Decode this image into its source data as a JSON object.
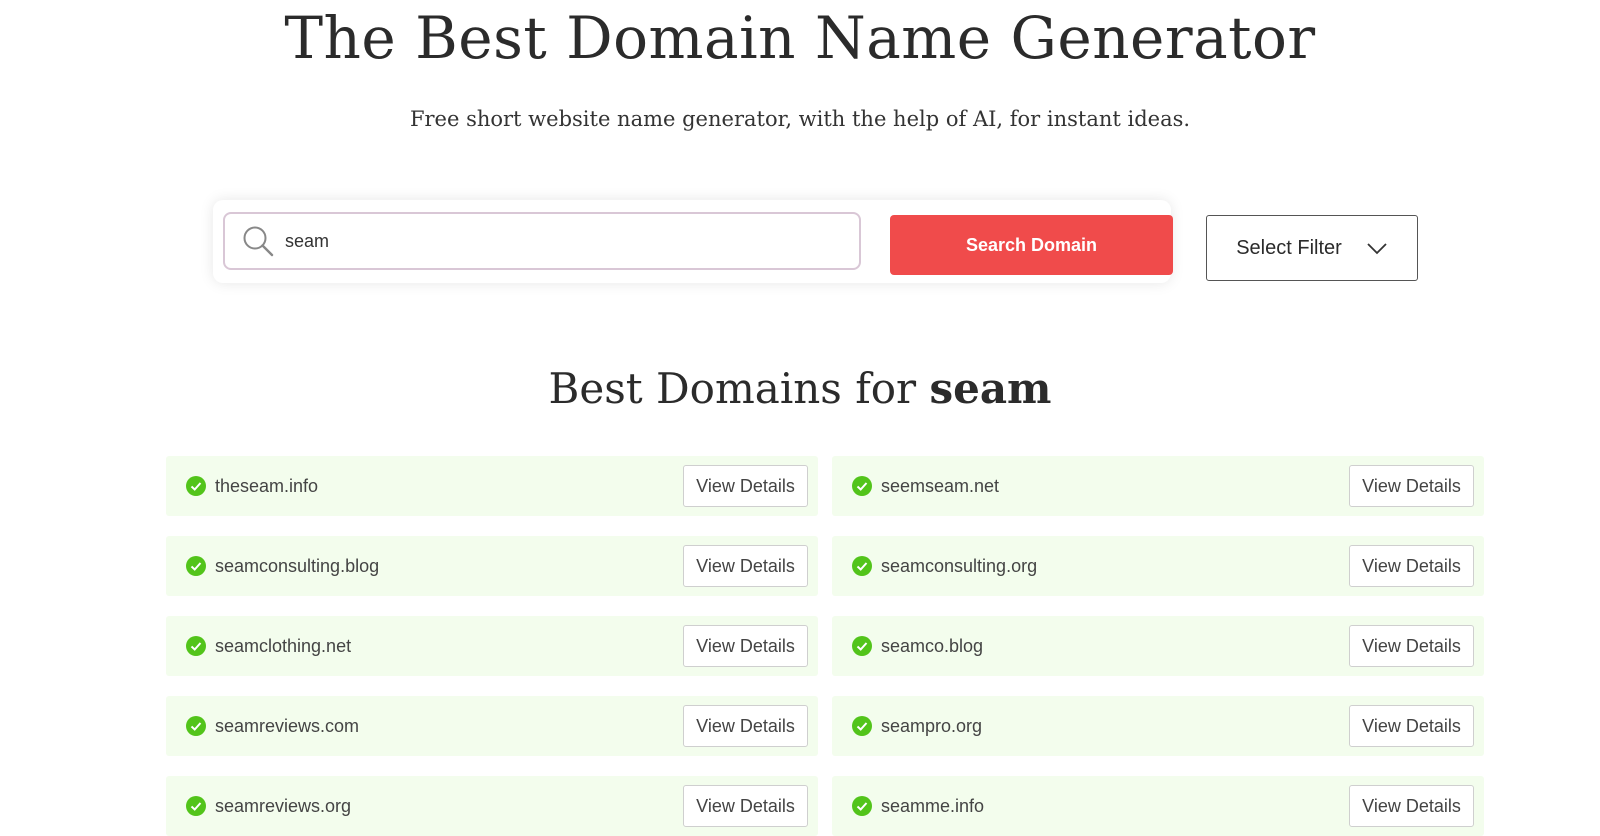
{
  "header": {
    "title": "The Best Domain Name Generator",
    "subtitle": "Free short website name generator, with the help of AI, for instant ideas."
  },
  "search": {
    "value": "seam",
    "button_label": "Search Domain",
    "icon": "search-icon"
  },
  "filter": {
    "label": "Select Filter",
    "icon": "chevron-down-icon"
  },
  "results": {
    "title_prefix": "Best Domains for",
    "query": "seam",
    "button_label": "View Details",
    "check_color": "#52c41a",
    "left": [
      "theseam.info",
      "seamconsulting.blog",
      "seamclothing.net",
      "seamreviews.com",
      "seamreviews.org"
    ],
    "right": [
      "seemseam.net",
      "seamconsulting.org",
      "seamco.blog",
      "seampro.org",
      "seamme.info"
    ]
  },
  "colors": {
    "accent": "#f04b4b",
    "row_bg": "#f3fded"
  }
}
